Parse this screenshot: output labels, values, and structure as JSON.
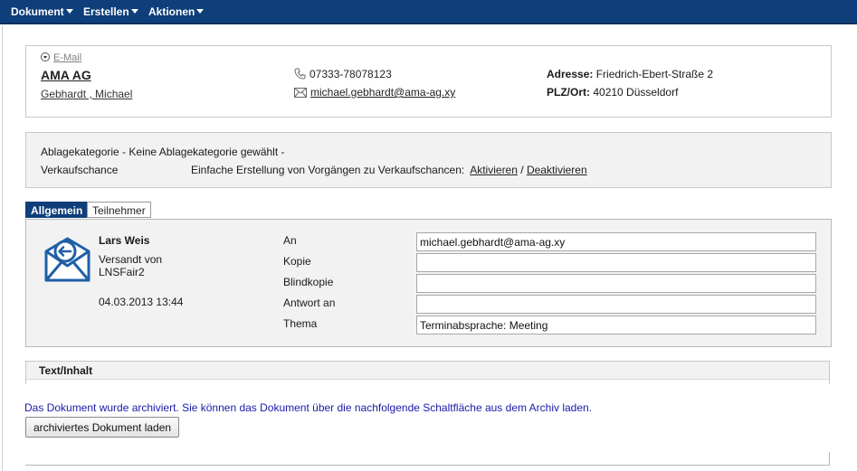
{
  "menu": [
    {
      "label": "Dokument"
    },
    {
      "label": "Erstellen"
    },
    {
      "label": "Aktionen"
    }
  ],
  "contact": {
    "email_toggle": "E-Mail",
    "company": "AMA AG",
    "person": "Gebhardt , Michael",
    "phone": "07333-78078123",
    "email": "michael.gebhardt@ama-ag.xy",
    "address_label": "Adresse:",
    "address": "Friedrich-Ebert-Straße 2",
    "city_label": "PLZ/Ort:",
    "city": "40210 Düsseldorf"
  },
  "category": {
    "line": "Ablagekategorie - Keine Ablagekategorie gewählt -",
    "chance_label": "Verkaufschance",
    "chance_text": "Einfache Erstellung von Vorgängen zu Verkaufschancen:",
    "activate": "Aktivieren",
    "separator": "/",
    "deactivate": "Deaktivieren"
  },
  "tabs": {
    "general": "Allgemein",
    "participants": "Teilnehmer"
  },
  "message": {
    "sender": "Lars Weis",
    "sent_via": "Versandt von LNSFair2",
    "date": "04.03.2013 13:44",
    "fields": {
      "to_label": "An",
      "to_value": "michael.gebhardt@ama-ag.xy",
      "cc_label": "Kopie",
      "cc_value": "",
      "bcc_label": "Blindkopie",
      "bcc_value": "",
      "reply_label": "Antwort an",
      "reply_value": "",
      "subject_label": "Thema",
      "subject_value": "Terminabsprache: Meeting"
    }
  },
  "content": {
    "header": "Text/Inhalt",
    "archive_note": "Das Dokument wurde archiviert. Sie können das Dokument über die nachfolgende Schaltfläche aus dem Archiv laden.",
    "load_button": "archiviertes Dokument laden"
  },
  "icons": {
    "phone": "phone-icon",
    "mail": "envelope-icon",
    "toggle": "collapse-circle-icon",
    "message": "incoming-mail-icon"
  },
  "colors": {
    "menubar": "#0e3f7a",
    "accent": "#1f5fa8",
    "note": "#1a1aaa"
  }
}
